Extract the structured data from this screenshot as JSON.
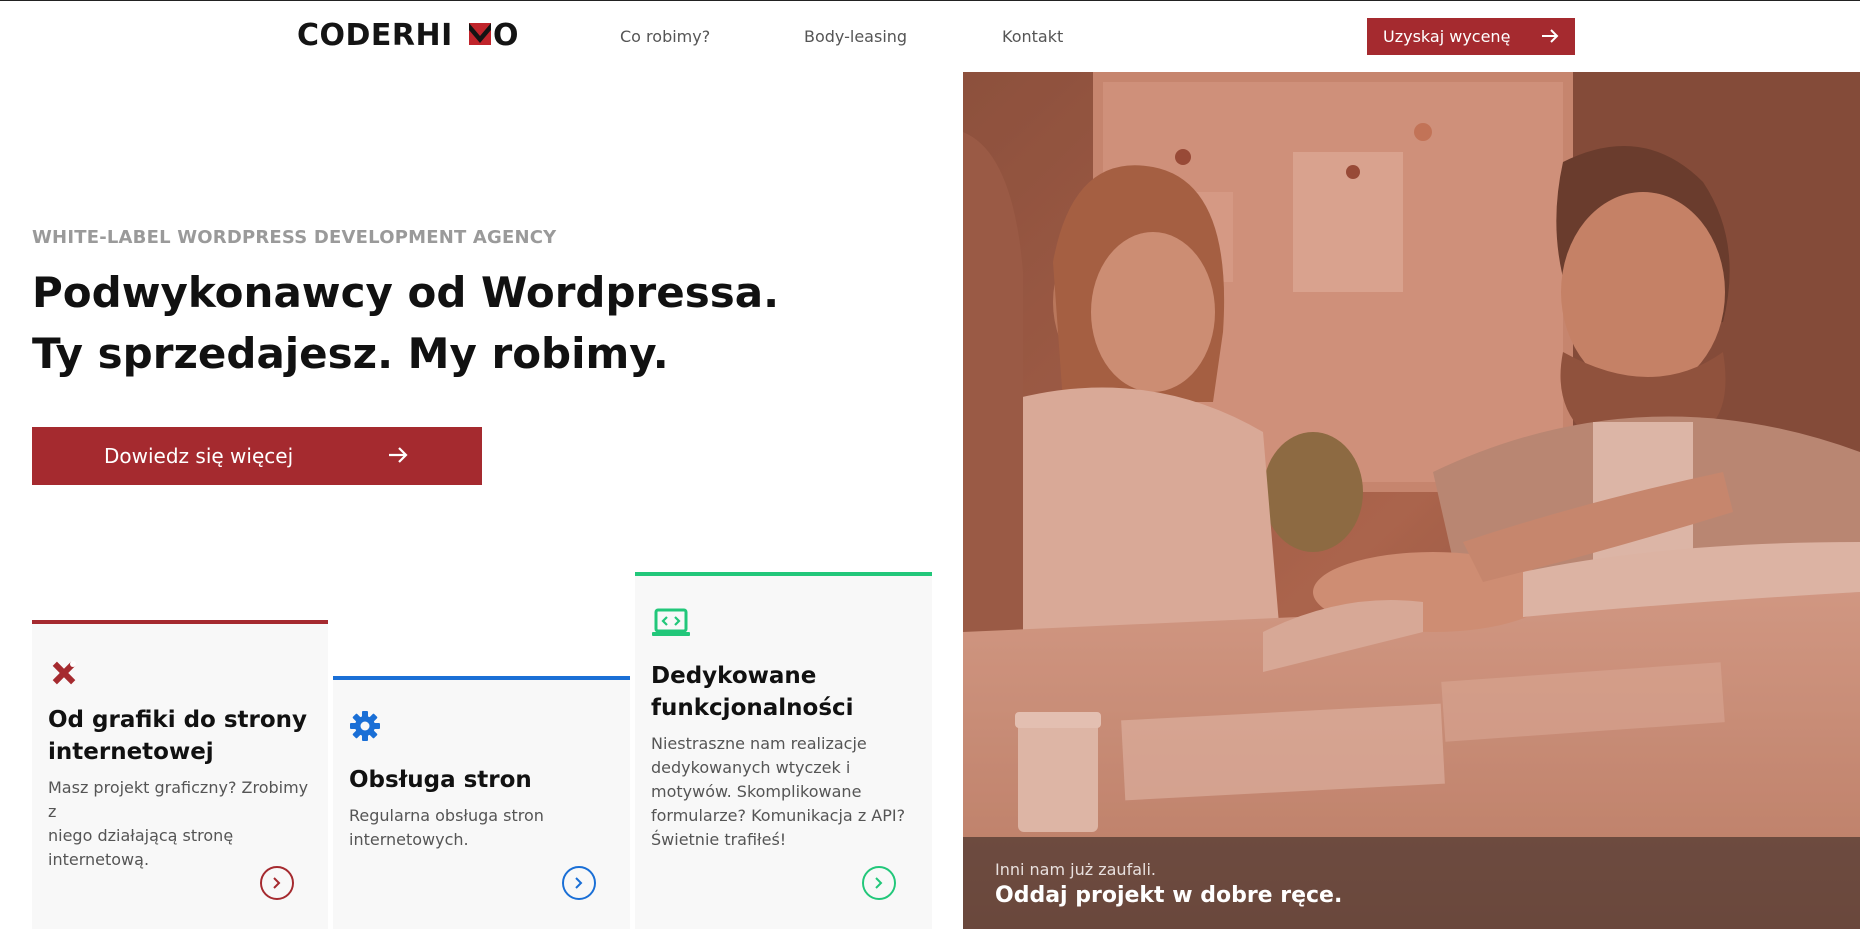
{
  "header": {
    "logo_text": "CODERHIVO",
    "nav": [
      "Co robimy?",
      "Body-leasing",
      "Kontakt"
    ],
    "cta_label": "Uzyskaj wycenę"
  },
  "hero": {
    "eyebrow": "WHITE-LABEL WORDPRESS DEVELOPMENT AGENCY",
    "headline_line1": "Podwykonawcy od Wordpressa.",
    "headline_line2": "Ty sprzedajesz. My robimy.",
    "cta_label": "Dowiedz się więcej"
  },
  "cards": [
    {
      "title_line1": "Od grafiki do strony",
      "title_line2": "internetowej",
      "text_line1": "Masz projekt graficzny? Zrobimy z",
      "text_line2": "niego działającą stronę",
      "text_line3": "internetową.",
      "icon": "design-tools-icon",
      "accent": "#a52a2f"
    },
    {
      "title_line1": "Obsługa stron",
      "text_line1": "Regularna obsługa stron",
      "text_line2": "internetowych.",
      "icon": "gear-icon",
      "accent": "#1a6fd6"
    },
    {
      "title_line1": "Dedykowane",
      "title_line2": "funkcjonalności",
      "text_line1": "Niestraszne nam realizacje",
      "text_line2": "dedykowanych wtyczek i",
      "text_line3": "motywów. Skomplikowane",
      "text_line4": "formularze? Komunikacja z API?",
      "text_line5": "Świetnie trafiłeś!",
      "icon": "code-laptop-icon",
      "accent": "#22c77a"
    }
  ],
  "photo": {
    "subtitle": "Inni nam już zaufali.",
    "title": "Oddaj projekt w dobre ręce."
  },
  "colors": {
    "brand_red": "#a52a2f",
    "blue": "#1a6fd6",
    "green": "#22c77a",
    "photo_tint": "#b86a52"
  }
}
